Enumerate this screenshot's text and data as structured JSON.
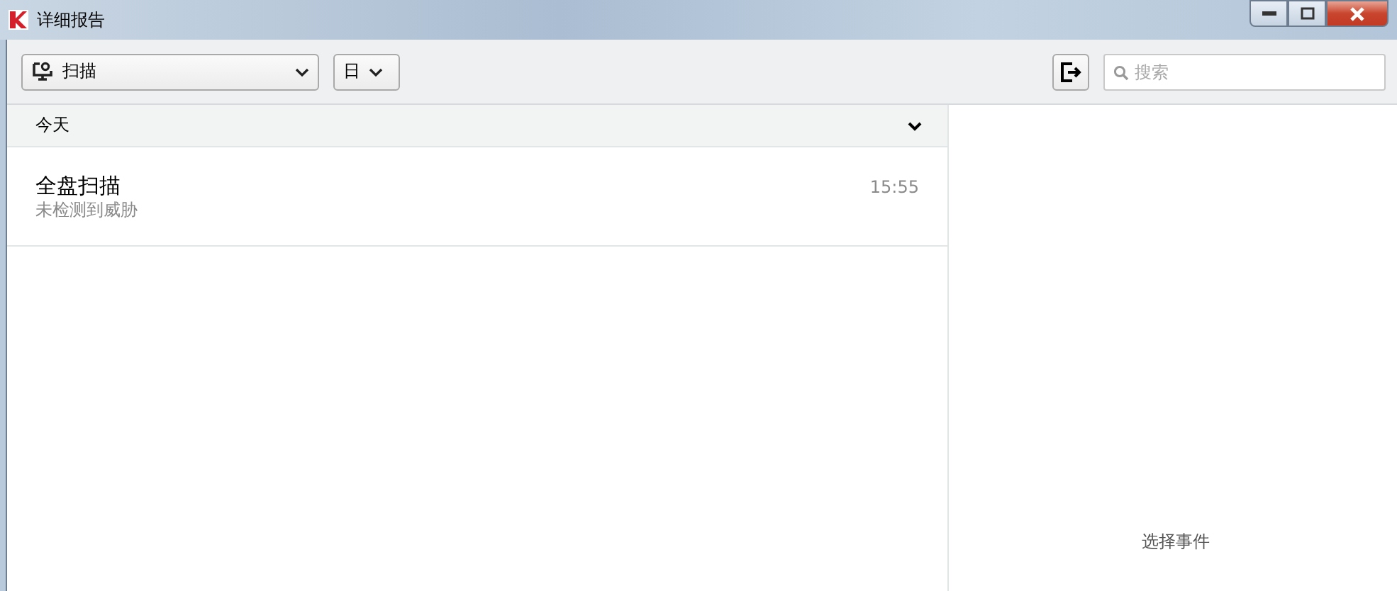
{
  "window": {
    "title": "详细报告"
  },
  "toolbar": {
    "category_dropdown": {
      "value": "扫描"
    },
    "period_dropdown": {
      "value": "日"
    },
    "search": {
      "placeholder": "搜索"
    }
  },
  "groups": [
    {
      "label": "今天",
      "expanded": true,
      "items": [
        {
          "title": "全盘扫描",
          "subtitle": "未检测到威胁",
          "time": "15:55"
        }
      ]
    }
  ],
  "detail_pane": {
    "hint": "选择事件"
  }
}
